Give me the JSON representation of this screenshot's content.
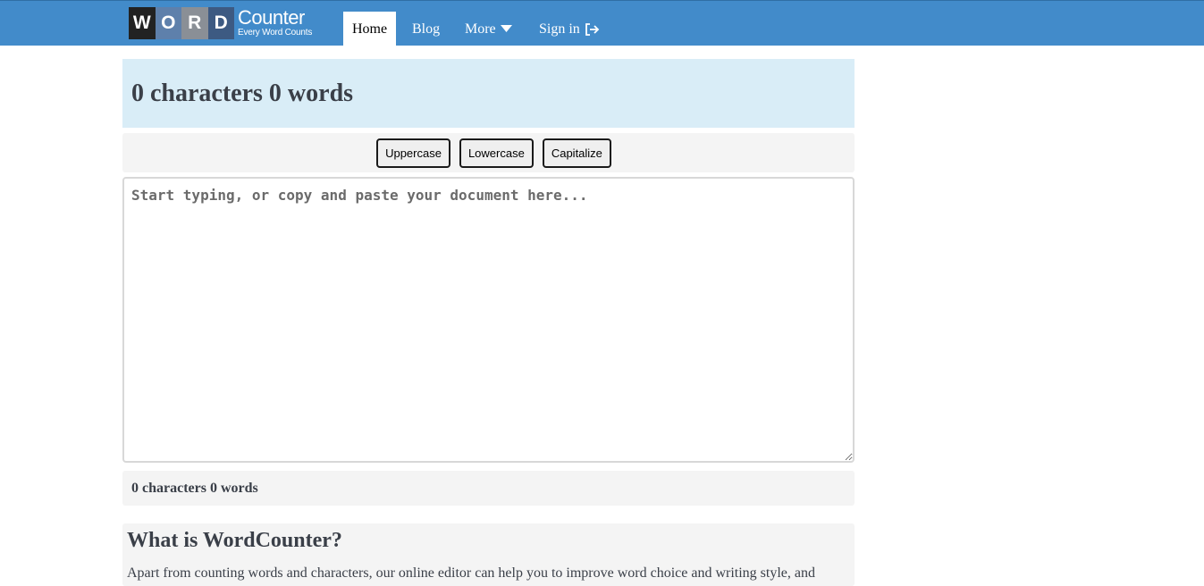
{
  "logo": {
    "letters": [
      "W",
      "O",
      "R",
      "D"
    ],
    "tile_colors": [
      "#222222",
      "#5e80ab",
      "#8a8f96",
      "#3d5a82"
    ],
    "main": "Counter",
    "sub": "Every Word Counts"
  },
  "nav": {
    "home": "Home",
    "blog": "Blog",
    "more": "More",
    "signin": "Sign in"
  },
  "banner": {
    "count_text": "0 characters 0 words"
  },
  "toolbar": {
    "uppercase": "Uppercase",
    "lowercase": "Lowercase",
    "capitalize": "Capitalize"
  },
  "editor": {
    "placeholder": "Start typing, or copy and paste your document here...",
    "value": ""
  },
  "footer_count": {
    "text": "0 characters 0 words"
  },
  "info": {
    "title": "What is WordCounter?",
    "body": "Apart from counting words and characters, our online editor can help you to improve word choice and writing style, and"
  },
  "colors": {
    "navbar": "#428bca",
    "banner": "#d9edf7",
    "panel": "#f4f4f4"
  }
}
